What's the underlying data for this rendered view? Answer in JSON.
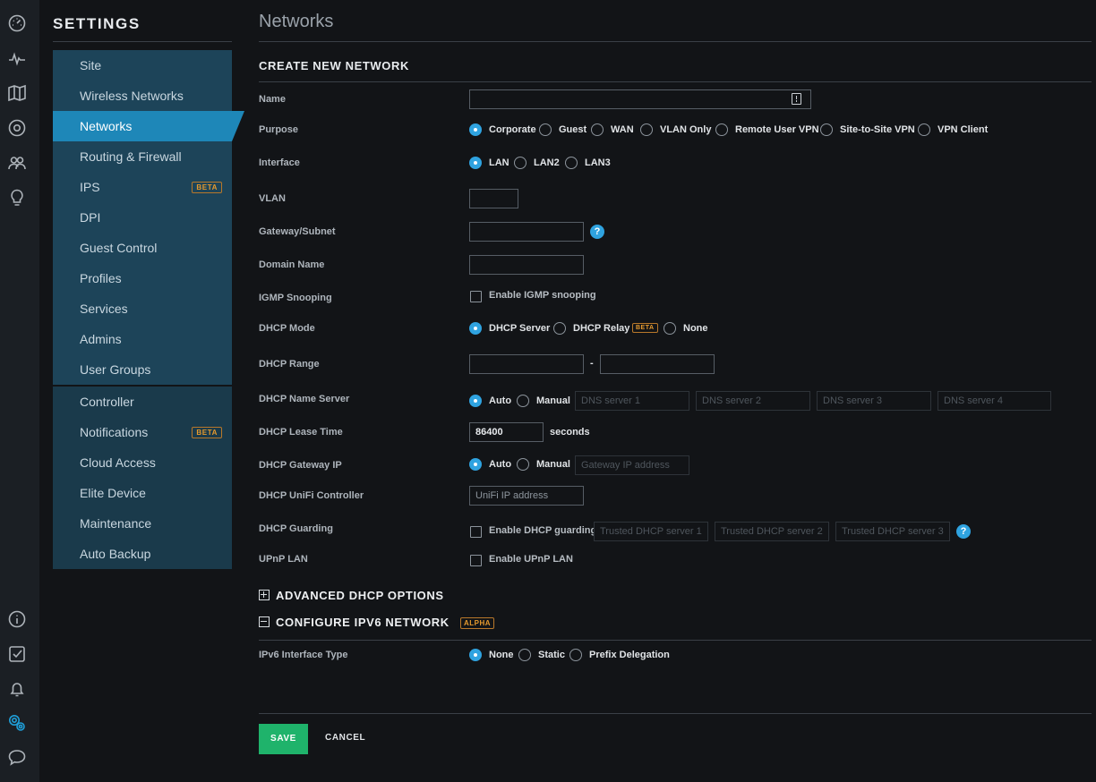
{
  "rail": {
    "icons": [
      "dashboard-icon",
      "statistics-icon",
      "map-icon",
      "devices-icon",
      "clients-icon",
      "insights-icon"
    ],
    "bottom_icons": [
      "info-icon",
      "tasks-icon",
      "alerts-icon",
      "settings-icon",
      "chat-icon"
    ]
  },
  "sidebar": {
    "title": "SETTINGS",
    "group1": [
      {
        "label": "Site"
      },
      {
        "label": "Wireless Networks"
      },
      {
        "label": "Networks"
      },
      {
        "label": "Routing & Firewall"
      },
      {
        "label": "IPS",
        "badge": "BETA"
      },
      {
        "label": "DPI"
      },
      {
        "label": "Guest Control"
      },
      {
        "label": "Profiles"
      },
      {
        "label": "Services"
      },
      {
        "label": "Admins"
      },
      {
        "label": "User Groups"
      }
    ],
    "group2": [
      {
        "label": "Controller"
      },
      {
        "label": "Notifications",
        "badge": "BETA"
      },
      {
        "label": "Cloud Access"
      },
      {
        "label": "Elite Device"
      },
      {
        "label": "Maintenance"
      },
      {
        "label": "Auto Backup"
      }
    ],
    "active": "Networks"
  },
  "main": {
    "page_title": "Networks",
    "section_title": "CREATE NEW NETWORK",
    "name": {
      "label": "Name",
      "value": ""
    },
    "purpose": {
      "label": "Purpose",
      "options": [
        "Corporate",
        "Guest",
        "WAN",
        "VLAN Only",
        "Remote User VPN",
        "Site-to-Site VPN",
        "VPN Client"
      ],
      "selected": "Corporate"
    },
    "interface": {
      "label": "Interface",
      "options": [
        "LAN",
        "LAN2",
        "LAN3"
      ],
      "selected": "LAN"
    },
    "vlan": {
      "label": "VLAN",
      "value": ""
    },
    "gateway_subnet": {
      "label": "Gateway/Subnet",
      "value": "",
      "help": "?"
    },
    "domain_name": {
      "label": "Domain Name",
      "value": ""
    },
    "igmp": {
      "label": "IGMP Snooping",
      "checkbox_label": "Enable IGMP snooping",
      "checked": false
    },
    "dhcp_mode": {
      "label": "DHCP Mode",
      "options": [
        "DHCP Server",
        "DHCP Relay",
        "None"
      ],
      "relay_badge": "BETA",
      "selected": "DHCP Server"
    },
    "dhcp_range": {
      "label": "DHCP Range",
      "start": "",
      "separator": "-",
      "end": ""
    },
    "dhcp_name_server": {
      "label": "DHCP Name Server",
      "options": [
        "Auto",
        "Manual"
      ],
      "selected": "Auto",
      "placeholders": [
        "DNS server 1",
        "DNS server 2",
        "DNS server 3",
        "DNS server 4"
      ]
    },
    "lease_time": {
      "label": "DHCP Lease Time",
      "value": "86400",
      "unit": "seconds"
    },
    "dhcp_gateway_ip": {
      "label": "DHCP Gateway IP",
      "options": [
        "Auto",
        "Manual"
      ],
      "selected": "Auto",
      "placeholder": "Gateway IP address"
    },
    "unifi_controller": {
      "label": "DHCP UniFi Controller",
      "placeholder": "UniFi IP address"
    },
    "dhcp_guarding": {
      "label": "DHCP Guarding",
      "checkbox_label": "Enable DHCP guarding",
      "checked": false,
      "placeholders": [
        "Trusted DHCP server 1",
        "Trusted DHCP server 2",
        "Trusted DHCP server 3"
      ],
      "help": "?"
    },
    "upnp": {
      "label": "UPnP LAN",
      "checkbox_label": "Enable UPnP LAN",
      "checked": false
    },
    "advanced_dhcp": {
      "label": "ADVANCED DHCP OPTIONS",
      "expanded": false
    },
    "ipv6": {
      "label": "CONFIGURE IPV6 NETWORK",
      "badge": "ALPHA",
      "expanded": true,
      "type_label": "IPv6 Interface Type",
      "options": [
        "None",
        "Static",
        "Prefix Delegation"
      ],
      "selected": "None"
    },
    "save_label": "SAVE",
    "cancel_label": "CANCEL"
  },
  "colors": {
    "accent": "#2fa3e0",
    "save": "#1fb36b",
    "beta": "#e69a2e",
    "sidebar": "#1d4459",
    "active": "#1e87b8"
  }
}
